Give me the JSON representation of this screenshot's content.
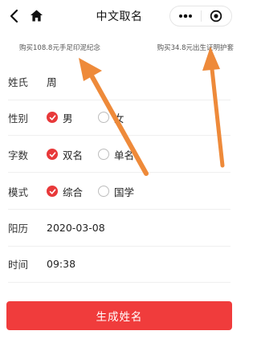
{
  "header": {
    "title": "中文取名"
  },
  "promos": {
    "left": "购买108.8元手足印泥纪念",
    "right": "购买34.8元出生证明护套"
  },
  "form": {
    "surname": {
      "label": "姓氏",
      "value": "周"
    },
    "gender": {
      "label": "性别",
      "options": [
        "男",
        "女"
      ],
      "selected": "男"
    },
    "count": {
      "label": "字数",
      "options": [
        "双名",
        "单名"
      ],
      "selected": "双名"
    },
    "mode": {
      "label": "模式",
      "options": [
        "综合",
        "国学"
      ],
      "selected": "综合"
    },
    "date": {
      "label": "阳历",
      "value": "2020-03-08"
    },
    "time": {
      "label": "时间",
      "value": "09:38"
    }
  },
  "submit": {
    "label": "生成姓名"
  },
  "colors": {
    "accent": "#f03c3c",
    "radio_on": "#e8393a",
    "annotation_arrow": "#ee8a3a"
  },
  "icons": [
    "back-icon",
    "home-icon",
    "more-dots-icon",
    "target-circle-icon",
    "checkmark-icon",
    "annotation-arrow"
  ]
}
